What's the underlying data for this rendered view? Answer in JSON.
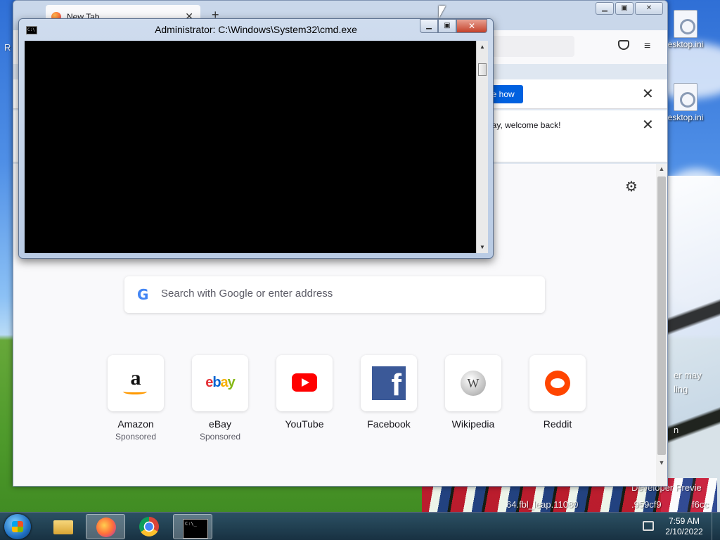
{
  "desktop": {
    "icons": [
      {
        "label": "esktop.ini"
      },
      {
        "label": "esktop.ini"
      }
    ],
    "left_fragment": "R",
    "watermark_fragments": [
      "er may",
      "ling",
      "n",
      "Developer Previe",
      "64.fbl_leap.11080",
      ".959cf9",
      "f6cc"
    ]
  },
  "firefox": {
    "tab_title": "New Tab",
    "new_tab_symbol": "+",
    "tab_close_symbol": "✕",
    "caption_buttons": {
      "minimize": "▁",
      "maximize": "▣",
      "close": "✕"
    },
    "menu_symbol": "≡",
    "notification_1": {
      "button_label": "ow me how",
      "close_symbol": "✕"
    },
    "notification_2": {
      "message": "way, welcome back!",
      "close_symbol": "✕"
    },
    "search": {
      "placeholder": "Search with Google or enter address",
      "g_glyph": "G"
    },
    "gear_symbol": "⚙",
    "scroll": {
      "up": "▲",
      "down": "▼"
    },
    "top_sites": [
      {
        "label": "Amazon",
        "sub": "Sponsored",
        "icon": "amazon-icon",
        "glyph": "a"
      },
      {
        "label": "eBay",
        "sub": "Sponsored",
        "icon": "ebay-icon",
        "glyph_parts": [
          "e",
          "b",
          "a",
          "y"
        ]
      },
      {
        "label": "YouTube",
        "sub": "",
        "icon": "youtube-icon"
      },
      {
        "label": "Facebook",
        "sub": "",
        "icon": "facebook-icon",
        "glyph": "f"
      },
      {
        "label": "Wikipedia",
        "sub": "",
        "icon": "wikipedia-icon",
        "glyph": "W"
      },
      {
        "label": "Reddit",
        "sub": "",
        "icon": "reddit-icon"
      }
    ]
  },
  "cmd": {
    "title": "Administrator: C:\\Windows\\System32\\cmd.exe",
    "sys_icon_text": "C:\\",
    "controls": {
      "minimize": "▁",
      "maximize": "▣",
      "close": "✕"
    },
    "scroll": {
      "up": "▲",
      "down": "▼"
    }
  },
  "taskbar": {
    "time": "7:59 AM",
    "date": "2/10/2022",
    "pinned": [
      "windows-explorer-icon",
      "firefox-icon",
      "chrome-icon",
      "cmd-icon"
    ]
  },
  "colors": {
    "firefox_accent": "#0061e0",
    "cmd_close": "#c4412a",
    "youtube_red": "#ff0000",
    "facebook_blue": "#3b5998",
    "reddit_orange": "#ff4500"
  }
}
